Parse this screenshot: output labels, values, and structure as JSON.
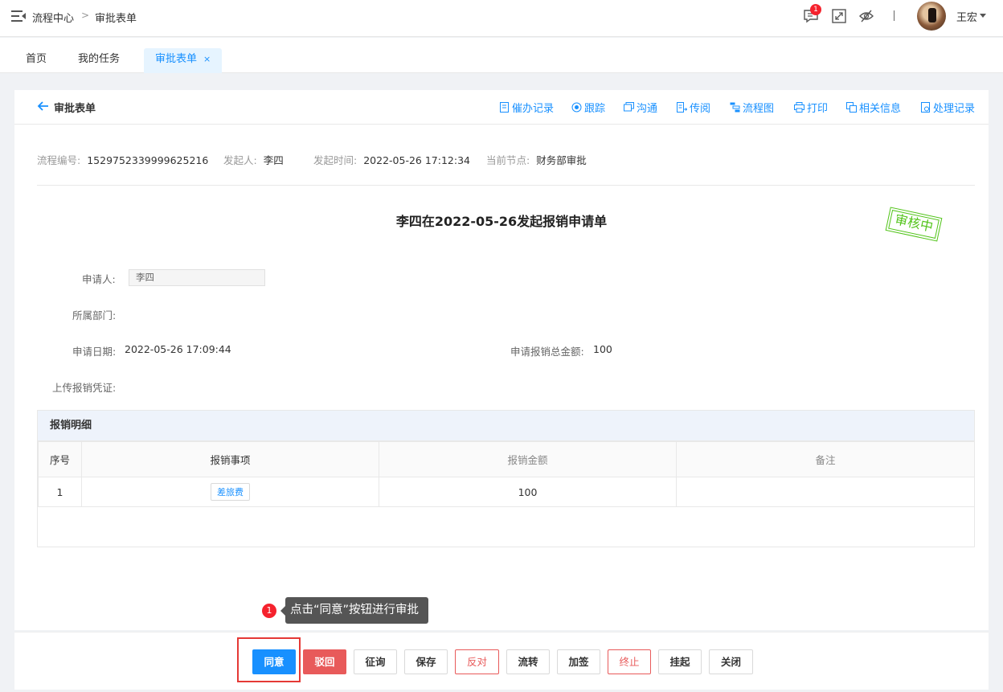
{
  "topbar": {
    "breadcrumb": [
      "流程中心",
      "审批表单"
    ],
    "breadcrumb_sep": ">",
    "notification_count": "1",
    "divider": "|",
    "username": "王宏"
  },
  "tabs": [
    {
      "label": "首页"
    },
    {
      "label": "我的任务"
    },
    {
      "label": "审批表单",
      "close": "×"
    }
  ],
  "card": {
    "title": "审批表单",
    "actions": [
      "催办记录",
      "跟踪",
      "沟通",
      "传阅",
      "流程图",
      "打印",
      "相关信息",
      "处理记录"
    ]
  },
  "meta": {
    "process_no_label": "流程编号:",
    "process_no": "1529752339999625216",
    "initiator_label": "发起人:",
    "initiator": "李四",
    "start_time_label": "发起时间:",
    "start_time": "2022-05-26 17:12:34",
    "node_label": "当前节点:",
    "node": "财务部审批"
  },
  "form": {
    "title": "李四在2022-05-26发起报销申请单",
    "stamp": "审核中",
    "applicant_label": "申请人:",
    "applicant": "李四",
    "department_label": "所属部门:",
    "date_label": "申请日期:",
    "date": "2022-05-26 17:09:44",
    "amount_label": "申请报销总金额:",
    "amount": "100",
    "voucher_label": "上传报销凭证:"
  },
  "detail": {
    "title": "报销明细",
    "columns": [
      "序号",
      "报销事项",
      "报销金额",
      "备注"
    ],
    "rows": [
      {
        "no": "1",
        "item": "差旅费",
        "amount": "100",
        "note": ""
      }
    ]
  },
  "tooltip": {
    "step": "1",
    "text": "点击“同意”按钮进行审批"
  },
  "footer": {
    "buttons": [
      "同意",
      "驳回",
      "征询",
      "保存",
      "反对",
      "流转",
      "加签",
      "终止",
      "挂起",
      "关闭"
    ]
  },
  "colors": {
    "primary": "#1890ff",
    "danger": "#e85a5a",
    "stamp": "#52c41a",
    "highlight": "#e53935"
  }
}
